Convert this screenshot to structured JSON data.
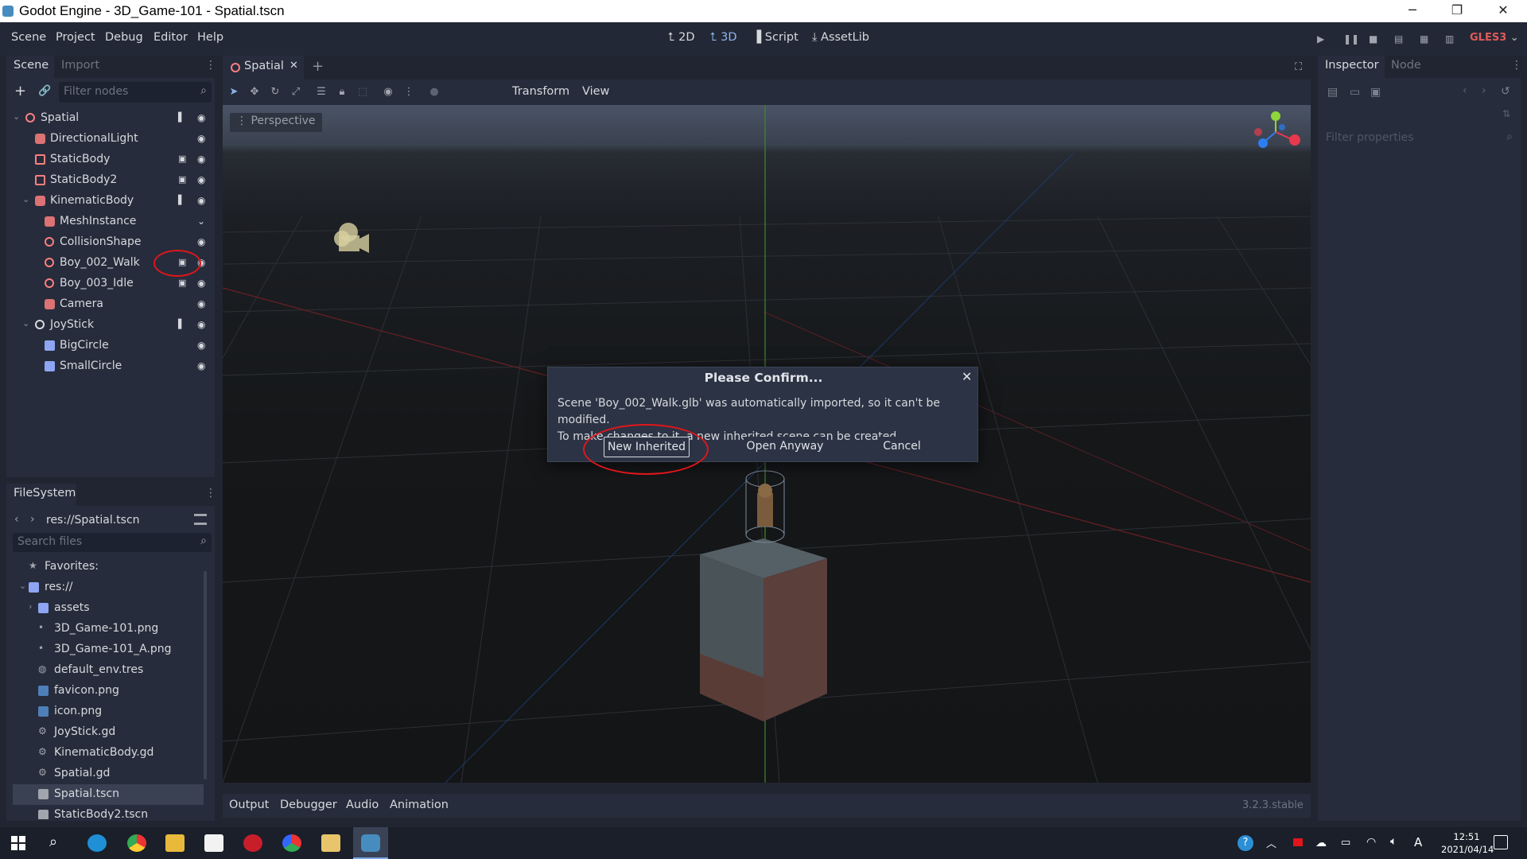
{
  "window": {
    "title": "Godot Engine - 3D_Game-101 - Spatial.tscn",
    "minimize": "─",
    "restore": "❐",
    "close": "✕"
  },
  "menu": [
    "Scene",
    "Project",
    "Debug",
    "Editor",
    "Help"
  ],
  "workspaces": [
    {
      "icon": "⮤",
      "label": "2D",
      "active": false
    },
    {
      "icon": "⮤",
      "label": "3D",
      "active": true
    },
    {
      "icon": "▐",
      "label": "Script",
      "active": false
    },
    {
      "icon": "⤓",
      "label": "AssetLib",
      "active": false
    }
  ],
  "renderer": "GLES3",
  "scene_dock": {
    "tabs": [
      "Scene",
      "Import"
    ],
    "filter_placeholder": "Filter nodes",
    "nodes": [
      {
        "name": "Spatial",
        "depth": 0,
        "expanded": true,
        "icon_color": "#fc7f7f",
        "icon_shape": "circle",
        "extra": "script"
      },
      {
        "name": "DirectionalLight",
        "depth": 1,
        "icon_color": "#fc7f7f",
        "icon_shape": "light",
        "extra": ""
      },
      {
        "name": "StaticBody",
        "depth": 1,
        "icon_color": "#fc7f7f",
        "icon_shape": "box",
        "extra": "clapper"
      },
      {
        "name": "StaticBody2",
        "depth": 1,
        "icon_color": "#fc7f7f",
        "icon_shape": "box",
        "extra": "clapper"
      },
      {
        "name": "KinematicBody",
        "depth": 1,
        "expanded": true,
        "icon_color": "#fc7f7f",
        "icon_shape": "kin",
        "extra": "script"
      },
      {
        "name": "MeshInstance",
        "depth": 2,
        "icon_color": "#fc7f7f",
        "icon_shape": "mesh",
        "extra": ""
      },
      {
        "name": "CollisionShape",
        "depth": 2,
        "icon_color": "#fc7f7f",
        "icon_shape": "circle",
        "extra": ""
      },
      {
        "name": "Boy_002_Walk",
        "depth": 2,
        "icon_color": "#fc7f7f",
        "icon_shape": "circle",
        "extra": "clapper"
      },
      {
        "name": "Boy_003_Idle",
        "depth": 2,
        "icon_color": "#fc7f7f",
        "icon_shape": "circle",
        "extra": "clapper"
      },
      {
        "name": "Camera",
        "depth": 2,
        "icon_color": "#fc7f7f",
        "icon_shape": "cam",
        "extra": ""
      },
      {
        "name": "JoyStick",
        "depth": 1,
        "expanded": true,
        "icon_color": "#d6d9de",
        "icon_shape": "circle",
        "extra": "script"
      },
      {
        "name": "BigCircle",
        "depth": 2,
        "icon_color": "#8da5f3",
        "icon_shape": "sprite",
        "extra": ""
      },
      {
        "name": "SmallCircle",
        "depth": 2,
        "icon_color": "#8da5f3",
        "icon_shape": "sprite",
        "extra": ""
      }
    ]
  },
  "filesystem": {
    "title": "FileSystem",
    "path": "res://Spatial.tscn",
    "search_placeholder": "Search files",
    "items": [
      {
        "name": "Favorites:",
        "depth": 0,
        "icon": "★",
        "selected": false
      },
      {
        "name": "res://",
        "depth": 0,
        "icon": "folder",
        "selected": false,
        "expanded": true
      },
      {
        "name": "assets",
        "depth": 1,
        "icon": "folder",
        "selected": false
      },
      {
        "name": "3D_Game-101.png",
        "depth": 1,
        "icon": "•",
        "selected": false
      },
      {
        "name": "3D_Game-101_A.png",
        "depth": 1,
        "icon": "•",
        "selected": false
      },
      {
        "name": "default_env.tres",
        "depth": 1,
        "icon": "◍",
        "selected": false
      },
      {
        "name": "favicon.png",
        "depth": 1,
        "icon": "img",
        "selected": false
      },
      {
        "name": "icon.png",
        "depth": 1,
        "icon": "img",
        "selected": false
      },
      {
        "name": "JoyStick.gd",
        "depth": 1,
        "icon": "⚙",
        "selected": false
      },
      {
        "name": "KinematicBody.gd",
        "depth": 1,
        "icon": "⚙",
        "selected": false
      },
      {
        "name": "Spatial.gd",
        "depth": 1,
        "icon": "⚙",
        "selected": false
      },
      {
        "name": "Spatial.tscn",
        "depth": 1,
        "icon": "clap",
        "selected": true
      },
      {
        "name": "StaticBody2.tscn",
        "depth": 1,
        "icon": "clap",
        "selected": false
      }
    ]
  },
  "editor_tabs": [
    {
      "label": "Spatial",
      "close": "✕"
    }
  ],
  "add_tab": "+",
  "viewport": {
    "menus": [
      "Transform",
      "View"
    ],
    "perspective_label": "Perspective"
  },
  "dialog": {
    "title": "Please Confirm...",
    "close": "✕",
    "message_line1": "Scene 'Boy_002_Walk.glb' was automatically imported, so it can't be modified.",
    "message_line2": "To make changes to it, a new inherited scene can be created.",
    "buttons": {
      "new_inherited": "New Inherited",
      "open_anyway": "Open Anyway",
      "cancel": "Cancel"
    }
  },
  "inspector": {
    "tabs": [
      "Inspector",
      "Node"
    ],
    "filter_placeholder": "Filter properties"
  },
  "bottom_panel": {
    "tabs": [
      "Output",
      "Debugger",
      "Audio",
      "Animation"
    ],
    "version": "3.2.3.stable"
  },
  "taskbar": {
    "time": "12:51",
    "date": "2021/04/14",
    "ime": "A"
  },
  "colors": {
    "accent": "#8fb5ec",
    "highlight_red": "#e0161b",
    "node3d": "#fc7f7f",
    "node2d": "#8da5f3"
  }
}
